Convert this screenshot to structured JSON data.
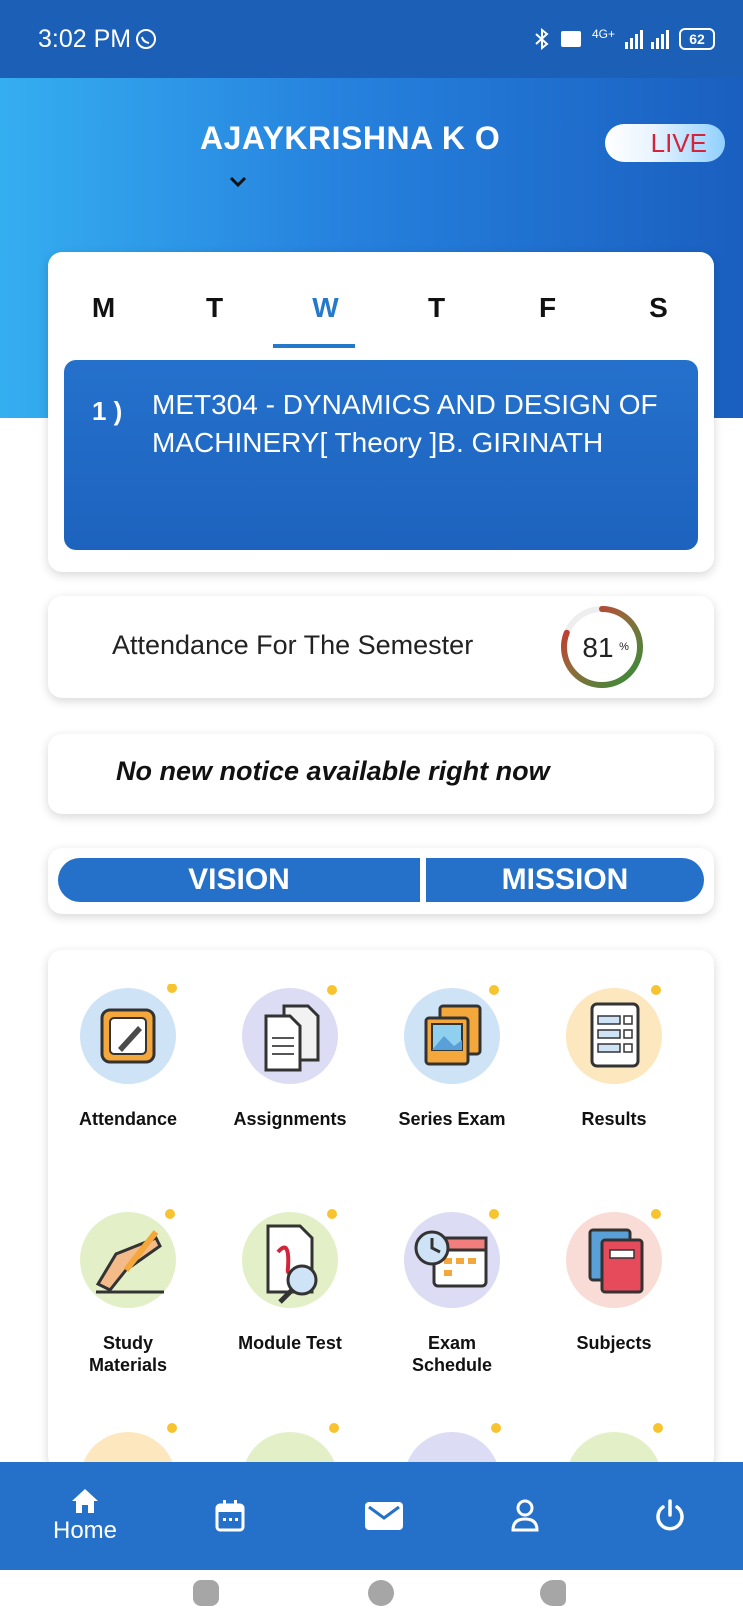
{
  "status_bar": {
    "time": "3:02 PM",
    "signal_text": "4G+",
    "battery": "62"
  },
  "header": {
    "user_name": "AJAYKRISHNA K O",
    "live_label": "LIVE"
  },
  "timetable": {
    "days": [
      "M",
      "T",
      "W",
      "T",
      "F",
      "S"
    ],
    "active_day_index": 2,
    "entries": [
      {
        "index": "1 )",
        "text": "MET304 - DYNAMICS AND DESIGN OF MACHINERY[ Theory ]B. GIRINATH"
      }
    ]
  },
  "attendance": {
    "label": "Attendance For The Semester",
    "percent_value": "81",
    "percent_symbol": "%",
    "fraction": 0.81
  },
  "notice": {
    "text": "No new notice available right now"
  },
  "vision_mission": {
    "vision_label": "VISION",
    "mission_label": "MISSION"
  },
  "menu": {
    "items": [
      {
        "label": "Attendance",
        "icon": "attendance-notepad-icon",
        "bg": "#cfe3f7"
      },
      {
        "label": "Assignments",
        "icon": "assignments-documents-icon",
        "bg": "#dcdcf5"
      },
      {
        "label": "Series Exam",
        "icon": "series-exam-picture-icon",
        "bg": "#cfe3f7"
      },
      {
        "label": "Results",
        "icon": "results-checklist-icon",
        "bg": "#fde7bf"
      },
      {
        "label": "Study\nMaterials",
        "icon": "study-materials-writing-icon",
        "bg": "#e3f0c7"
      },
      {
        "label": "Module Test",
        "icon": "module-test-pdf-icon",
        "bg": "#e3f0c7"
      },
      {
        "label": "Exam\nSchedule",
        "icon": "exam-schedule-calendar-icon",
        "bg": "#dcdcf5"
      },
      {
        "label": "Subjects",
        "icon": "subjects-books-icon",
        "bg": "#fadcd6"
      }
    ]
  },
  "bottom_nav": {
    "home_label": "Home"
  },
  "colors": {
    "primary": "#2571c9",
    "status_bar": "#1b5fb7",
    "live_text": "#d3243a"
  }
}
